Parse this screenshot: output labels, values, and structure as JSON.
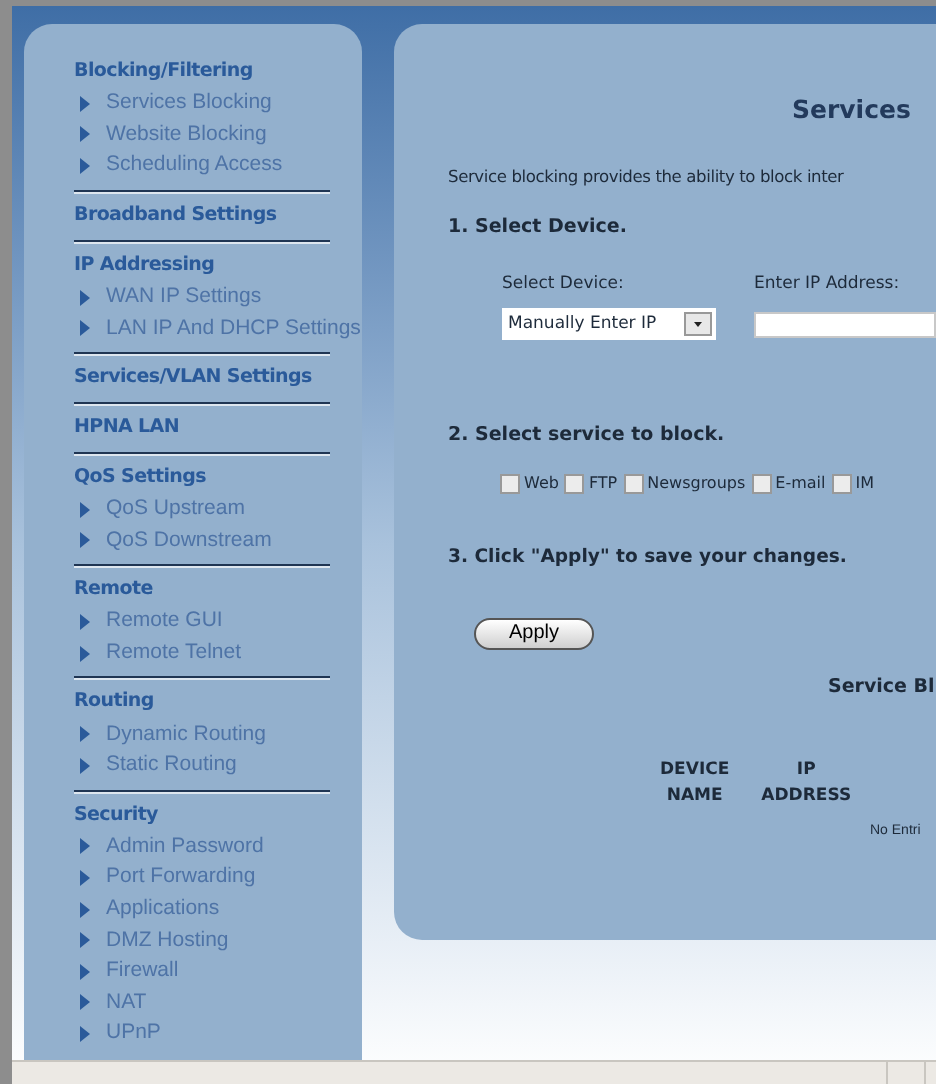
{
  "sidebar": {
    "sections": [
      {
        "title": "Blocking/Filtering",
        "items": [
          "Services Blocking",
          "Website Blocking",
          "Scheduling Access"
        ]
      },
      {
        "title": "Broadband Settings"
      },
      {
        "title": "IP Addressing",
        "items": [
          "WAN IP Settings",
          "LAN IP And DHCP Settings"
        ]
      },
      {
        "title": "Services/VLAN Settings"
      },
      {
        "title": "HPNA LAN"
      },
      {
        "title": "QoS Settings",
        "items": [
          "QoS Upstream",
          "QoS Downstream"
        ]
      },
      {
        "title": "Remote",
        "items": [
          "Remote GUI",
          "Remote Telnet"
        ]
      },
      {
        "title": "Routing",
        "items": [
          "Dynamic Routing",
          "Static Routing"
        ]
      },
      {
        "title": "Security",
        "items": [
          "Admin Password",
          "Port Forwarding",
          "Applications",
          "DMZ Hosting",
          "Firewall",
          "NAT",
          "UPnP"
        ]
      }
    ]
  },
  "main": {
    "title": "Services",
    "description": "Service blocking provides the ability to block inter",
    "step_1": {
      "heading": "1. Select Device.",
      "device_label": "Select Device:",
      "ip_label": "Enter IP Address:",
      "device_value": "Manually Enter IP"
    },
    "step_2": {
      "heading": "2. Select service to block.",
      "services": [
        {
          "label": "Web",
          "checked": false
        },
        {
          "label": "FTP",
          "checked": false
        },
        {
          "label": "Newsgroups",
          "checked": false
        },
        {
          "label": "E-mail",
          "checked": false
        },
        {
          "label": "IM",
          "checked": false
        }
      ]
    },
    "step_3": {
      "heading": "3. Click \"Apply\" to save your changes.",
      "button": "Apply"
    },
    "table": {
      "title": "Service Bl",
      "columns": [
        [
          "DEVICE",
          "NAME"
        ],
        [
          "IP",
          "ADDRESS"
        ]
      ],
      "empty": "No Entri"
    }
  }
}
